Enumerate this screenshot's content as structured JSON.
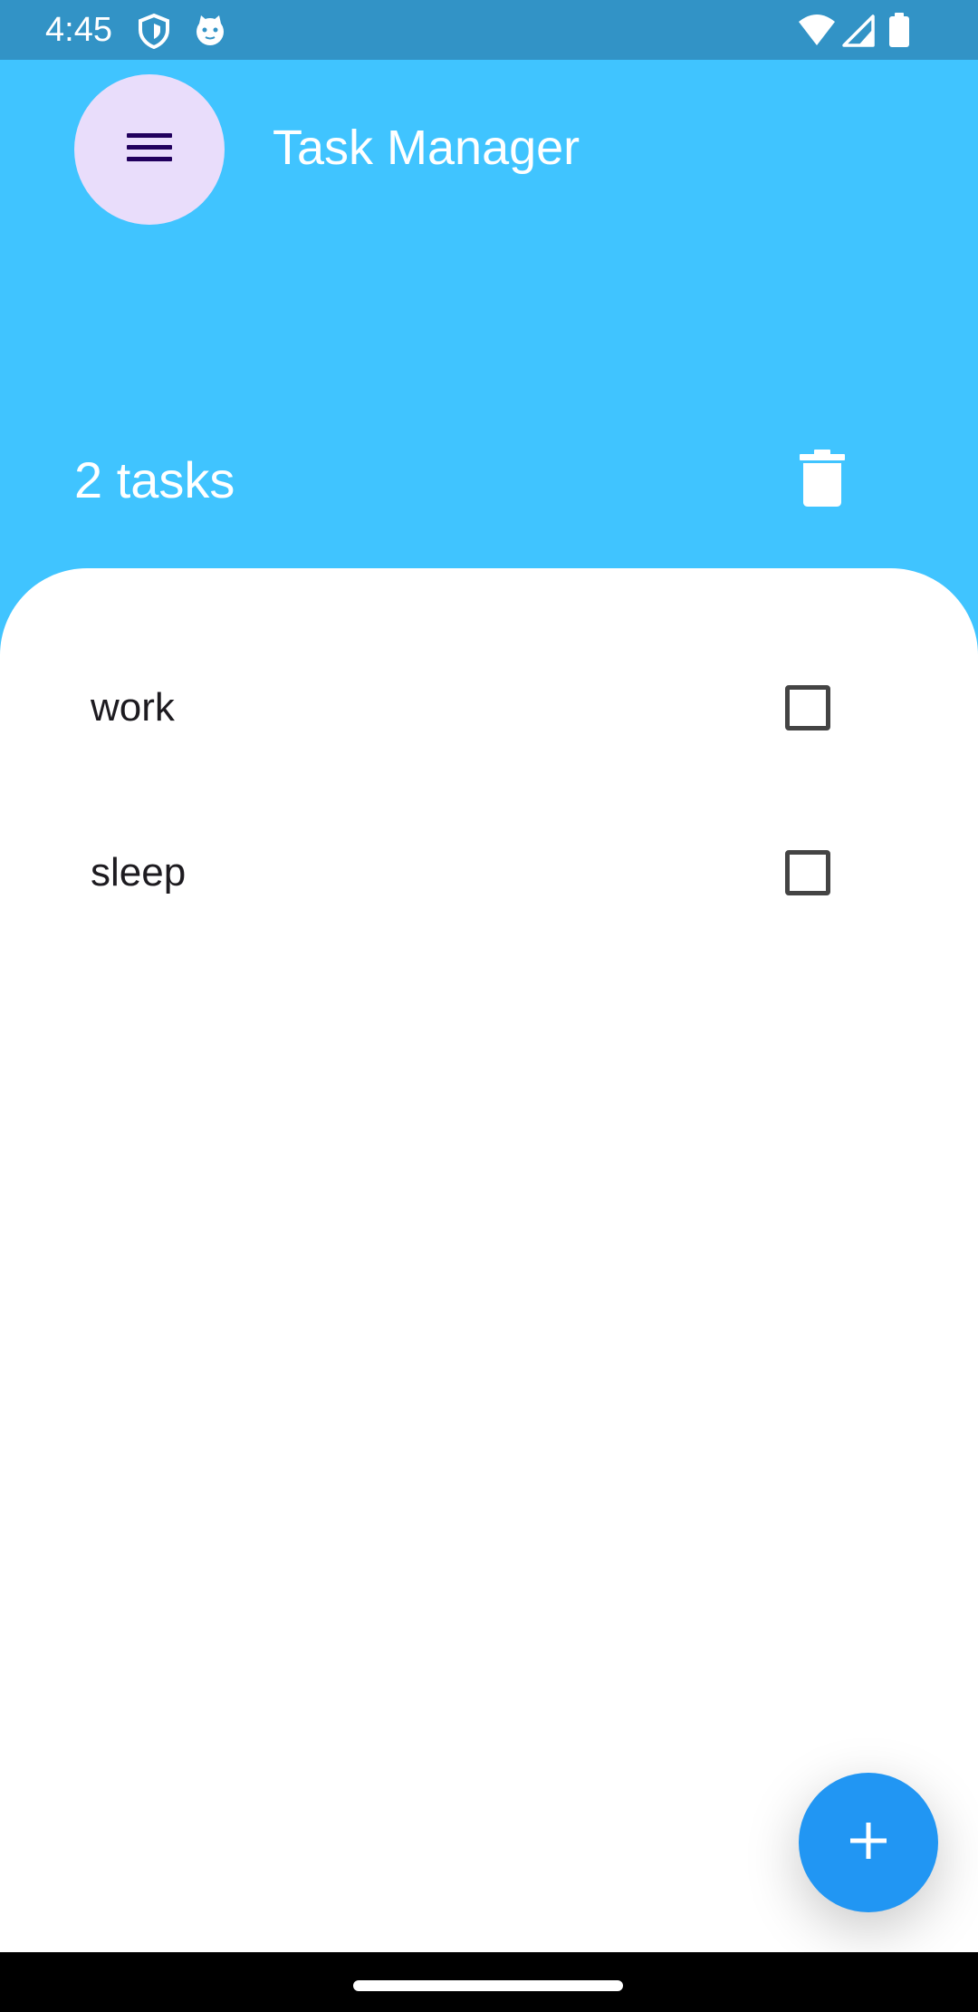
{
  "status_bar": {
    "time": "4:45",
    "left_icons": [
      "shield-icon",
      "cat-face-icon"
    ],
    "right_icons": [
      "wifi-icon",
      "cell-signal-icon",
      "battery-icon"
    ]
  },
  "app_bar": {
    "title": "Task Manager",
    "menu_icon": "hamburger-menu-icon"
  },
  "summary": {
    "task_count_text": "2 tasks",
    "delete_icon": "trash-icon"
  },
  "tasks": [
    {
      "label": "work",
      "checked": false
    },
    {
      "label": "sleep",
      "checked": false
    }
  ],
  "fab": {
    "icon": "plus-icon"
  },
  "colors": {
    "header_bg": "#40C4FF",
    "status_bar_bg": "#3293C6",
    "menu_button_bg": "#E9DDFB",
    "fab_bg": "#2196F3",
    "sheet_bg": "#FFFFFF"
  }
}
